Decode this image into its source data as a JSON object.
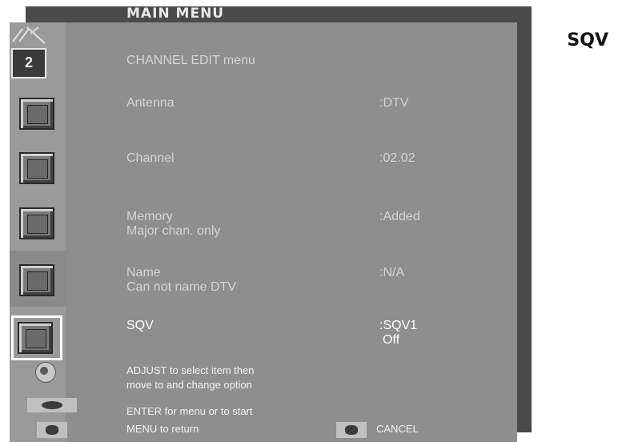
{
  "window": {
    "title": "MAIN MENU"
  },
  "side_label": "SQV",
  "channel_badge": "2",
  "menu": {
    "heading": "CHANNEL EDIT menu",
    "items": [
      {
        "label": "Antenna",
        "sub": "",
        "value": ":DTV",
        "value2": ""
      },
      {
        "label": "Channel",
        "sub": "",
        "value": ":02.02",
        "value2": ""
      },
      {
        "label": "Memory",
        "sub": "Major chan. only",
        "value": ":Added",
        "value2": ""
      },
      {
        "label": "Name",
        "sub": "Can not name DTV",
        "value": ":N/A",
        "value2": ""
      },
      {
        "label": "SQV",
        "sub": "",
        "value": ":SQV1",
        "value2": "Off"
      }
    ]
  },
  "help": {
    "adjust_line1": "ADJUST to select item then",
    "adjust_line2": "move to and change option",
    "enter": "ENTER for menu or to start",
    "menu": "MENU to return",
    "cancel": "CANCEL"
  },
  "icons": {
    "antenna": "antenna-icon",
    "tv": "tv-channel-icon",
    "item": "menu-item-icon",
    "knob": "adjust-knob-icon",
    "enter": "enter-button-icon",
    "menu": "menu-button-icon",
    "cancel": "cancel-button-icon"
  },
  "colors": {
    "panel": "#8e8e8e",
    "titlebar": "#4a4a4a",
    "highlight": "#ffffff"
  }
}
